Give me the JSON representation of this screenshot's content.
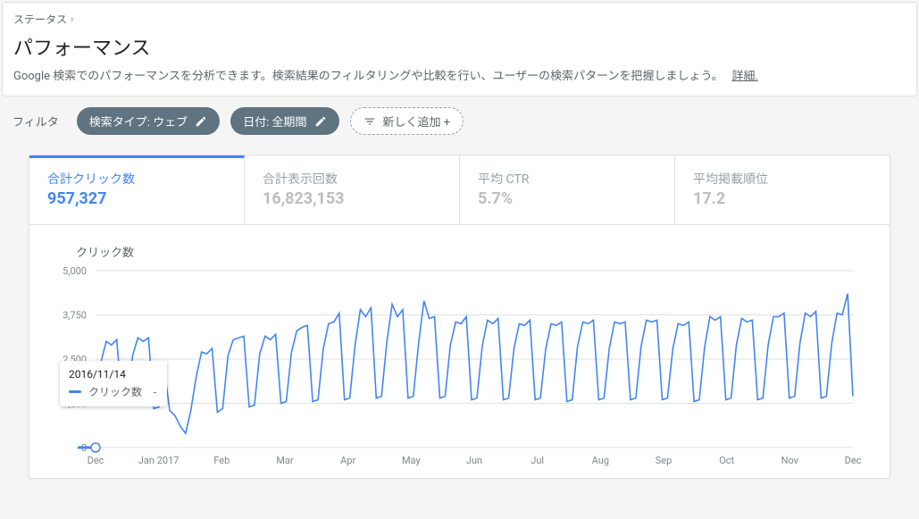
{
  "breadcrumb": {
    "parent": "ステータス"
  },
  "header": {
    "title": "パフォーマンス",
    "description": "Google 検索でのパフォーマンスを分析できます。検索結果のフィルタリングや比較を行い、ユーザーの検索パターンを把握しましょう。",
    "more": "詳細."
  },
  "filters": {
    "label": "フィルタ",
    "chip_search_type": "検索タイプ: ウェブ",
    "chip_date": "日付: 全期間",
    "chip_add": "新しく追加 +"
  },
  "metrics": {
    "clicks": {
      "title": "合計クリック数",
      "value": "957,327"
    },
    "impressions": {
      "title": "合計表示回数",
      "value": "16,823,153"
    },
    "ctr": {
      "title": "平均 CTR",
      "value": "5.7%"
    },
    "position": {
      "title": "平均掲載順位",
      "value": "17.2"
    }
  },
  "tooltip": {
    "date": "2016/11/14",
    "metric": "クリック数",
    "value": "-"
  },
  "chart_data": {
    "type": "line",
    "title": "クリック数",
    "ylabel": "",
    "xlabel": "",
    "ylim": [
      0,
      5000
    ],
    "yticks": [
      0,
      1250,
      2500,
      3750,
      5000
    ],
    "xticks": [
      "Dec",
      "Jan 2017",
      "Feb",
      "Mar",
      "Apr",
      "May",
      "Jun",
      "Jul",
      "Aug",
      "Sep",
      "Oct",
      "Nov",
      "Dec"
    ],
    "series": [
      {
        "name": "クリック数",
        "color": "#4285f4",
        "values": [
          2100,
          2400,
          3000,
          2900,
          3050,
          1200,
          1250,
          2600,
          3100,
          3000,
          3100,
          1100,
          1150,
          2200,
          1050,
          900,
          600,
          400,
          1050,
          2000,
          2700,
          2650,
          2800,
          1000,
          1100,
          2600,
          3050,
          3100,
          3150,
          1150,
          1200,
          2650,
          3150,
          3050,
          3200,
          1250,
          1300,
          2700,
          3300,
          3400,
          3450,
          1300,
          1350,
          2800,
          3500,
          3550,
          3800,
          1350,
          1400,
          2900,
          3900,
          3700,
          3950,
          1400,
          1450,
          3000,
          4050,
          3700,
          3900,
          1400,
          1450,
          2950,
          4150,
          3650,
          3700,
          1400,
          1450,
          2900,
          3550,
          3500,
          3700,
          1350,
          1400,
          2850,
          3600,
          3500,
          3650,
          1350,
          1400,
          2800,
          3500,
          3450,
          3600,
          1350,
          1400,
          2800,
          3500,
          3450,
          3550,
          1300,
          1350,
          2850,
          3550,
          3500,
          3600,
          1350,
          1400,
          2800,
          3550,
          3500,
          3550,
          1350,
          1400,
          2850,
          3600,
          3550,
          3600,
          1350,
          1400,
          2800,
          3500,
          3450,
          3550,
          1300,
          1350,
          2850,
          3700,
          3600,
          3700,
          1350,
          1400,
          2900,
          3650,
          3550,
          3600,
          1350,
          1400,
          2900,
          3700,
          3700,
          3800,
          1400,
          1450,
          2950,
          3800,
          3700,
          3850,
          1400,
          1450,
          2950,
          3800,
          3750,
          4350,
          1450
        ]
      }
    ]
  }
}
